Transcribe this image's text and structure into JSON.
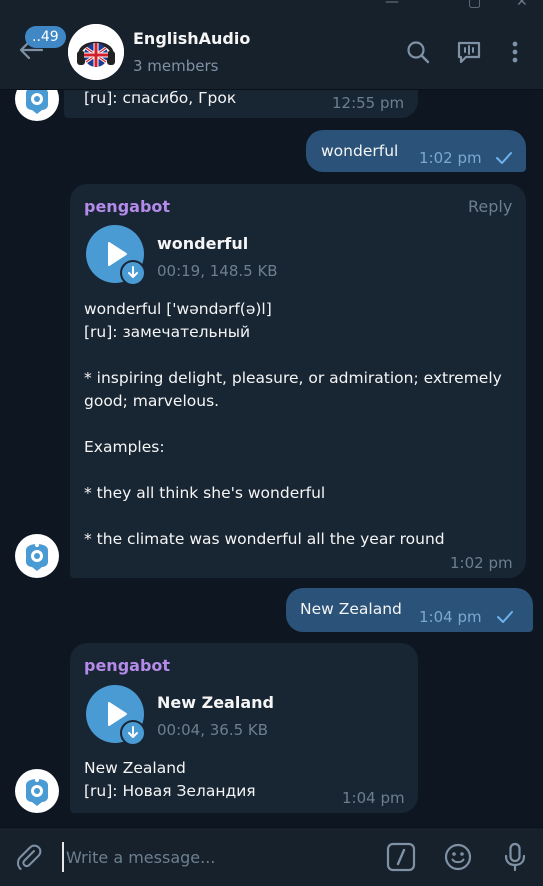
{
  "window": {
    "minimize": "—",
    "maximize": "▢",
    "close": "✕"
  },
  "header": {
    "unread_count": "..49",
    "title": "EnglishAudio",
    "subtitle": "3 members"
  },
  "colors": {
    "accent": "#4a9ad4",
    "outgoing_bubble": "#2b5278",
    "incoming_bubble": "#182533",
    "sender_name": "#b48be9",
    "background": "#0e1621"
  },
  "messages": [
    {
      "direction": "in",
      "text": "[ru]: спасибо, Грок",
      "time": "12:55 pm"
    },
    {
      "direction": "out",
      "text": "wonderful",
      "time": "1:02 pm",
      "status": "read"
    },
    {
      "direction": "in",
      "sender": "pengabot",
      "reply_label": "Reply",
      "audio": {
        "title": "wonderful",
        "meta": "00:19, 148.5 KB"
      },
      "text": "wonderful ['wəndərf(ə)l]\n[ru]: замечательный\n\n* inspiring delight, pleasure, or admiration; extremely\ngood; marvelous.\n\nExamples:\n\n* they all think she's wonderful\n\n* the climate was wonderful all the year round",
      "time": "1:02 pm"
    },
    {
      "direction": "out",
      "text": "New Zealand",
      "time": "1:04 pm",
      "status": "read"
    },
    {
      "direction": "in",
      "sender": "pengabot",
      "audio": {
        "title": "New Zealand",
        "meta": "00:04, 36.5 KB"
      },
      "text": "New Zealand\n[ru]: Новая Зеландия",
      "time": "1:04 pm"
    }
  ],
  "composer": {
    "placeholder": "Write a message..."
  },
  "icons": {
    "back": "back-arrow-icon",
    "search": "search-icon",
    "voice_chat": "voice-chat-icon",
    "menu": "more-vertical-icon",
    "attach": "paperclip-icon",
    "commands": "bot-commands-icon",
    "emoji": "emoji-icon",
    "mic": "microphone-icon"
  }
}
